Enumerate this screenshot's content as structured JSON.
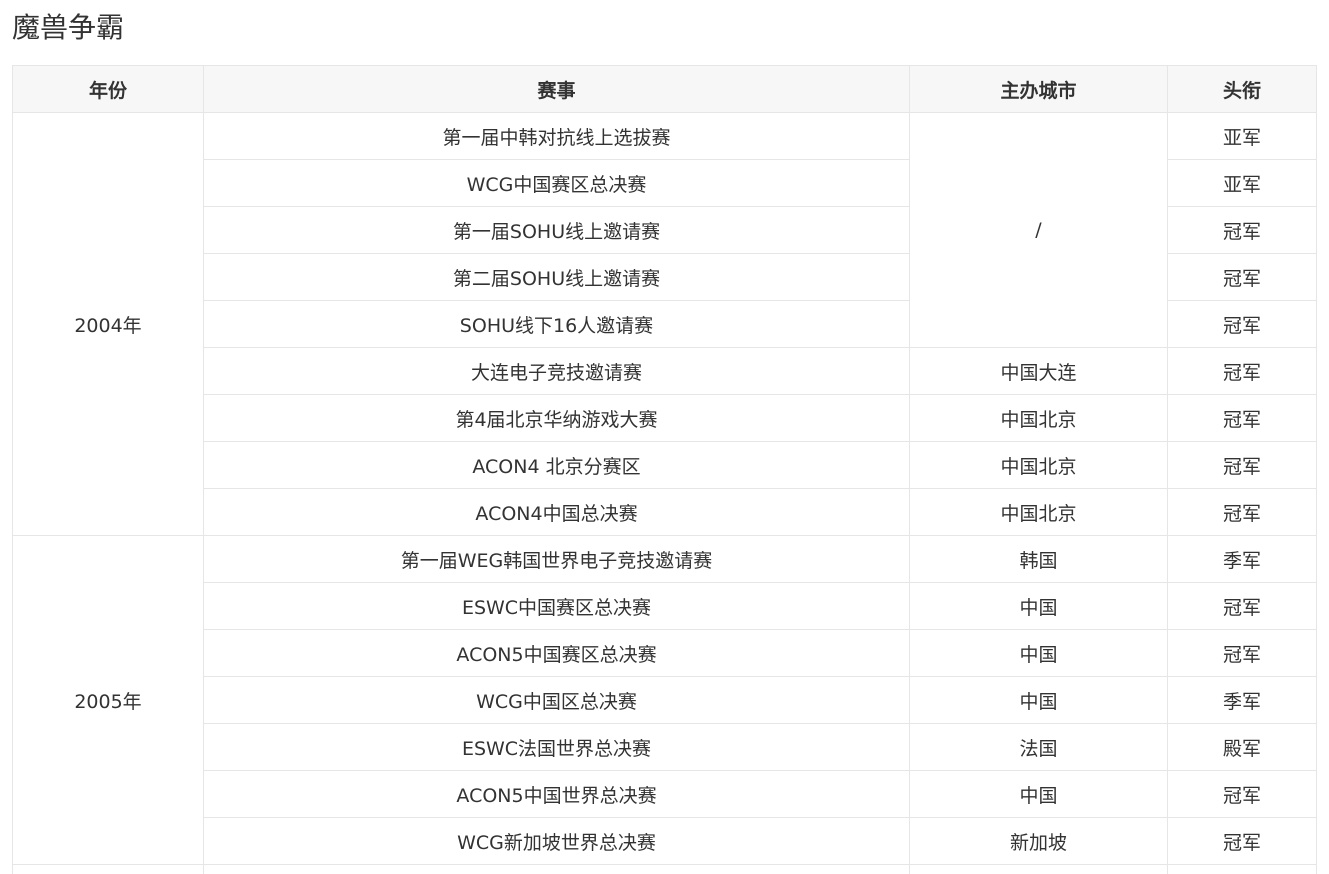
{
  "page": {
    "title": "魔兽争霸"
  },
  "table": {
    "headers": {
      "year": "年份",
      "event": "赛事",
      "city": "主办城市",
      "title": "头衔"
    },
    "groups": [
      {
        "year": "2004年",
        "city_blocks": [
          {
            "city": "/",
            "span": 5
          },
          {
            "city": "中国大连",
            "span": 1
          },
          {
            "city": "中国北京",
            "span": 1
          },
          {
            "city": "中国北京",
            "span": 1
          },
          {
            "city": "中国北京",
            "span": 1
          }
        ],
        "rows": [
          {
            "event": "第一届中韩对抗线上选拔赛",
            "title": "亚军"
          },
          {
            "event": "WCG中国赛区总决赛",
            "title": "亚军"
          },
          {
            "event": "第一届SOHU线上邀请赛",
            "title": "冠军"
          },
          {
            "event": "第二届SOHU线上邀请赛",
            "title": "冠军"
          },
          {
            "event": "SOHU线下16人邀请赛",
            "title": "冠军"
          },
          {
            "event": "大连电子竞技邀请赛",
            "title": "冠军"
          },
          {
            "event": "第4届北京华纳游戏大赛",
            "title": "冠军"
          },
          {
            "event": "ACON4 北京分赛区",
            "title": "冠军"
          },
          {
            "event": "ACON4中国总决赛",
            "title": "冠军"
          }
        ]
      },
      {
        "year": "2005年",
        "city_blocks": [
          {
            "city": "韩国",
            "span": 1
          },
          {
            "city": "中国",
            "span": 1
          },
          {
            "city": "中国",
            "span": 1
          },
          {
            "city": "中国",
            "span": 1
          },
          {
            "city": "法国",
            "span": 1
          },
          {
            "city": "中国",
            "span": 1
          },
          {
            "city": "新加坡",
            "span": 1
          }
        ],
        "rows": [
          {
            "event": "第一届WEG韩国世界电子竞技邀请赛",
            "title": "季军"
          },
          {
            "event": "ESWC中国赛区总决赛",
            "title": "冠军"
          },
          {
            "event": "ACON5中国赛区总决赛",
            "title": "冠军"
          },
          {
            "event": "WCG中国区总决赛",
            "title": "季军"
          },
          {
            "event": "ESWC法国世界总决赛",
            "title": "殿军"
          },
          {
            "event": "ACON5中国世界总决赛",
            "title": "冠军"
          },
          {
            "event": "WCG新加坡世界总决赛",
            "title": "冠军"
          }
        ]
      }
    ]
  }
}
